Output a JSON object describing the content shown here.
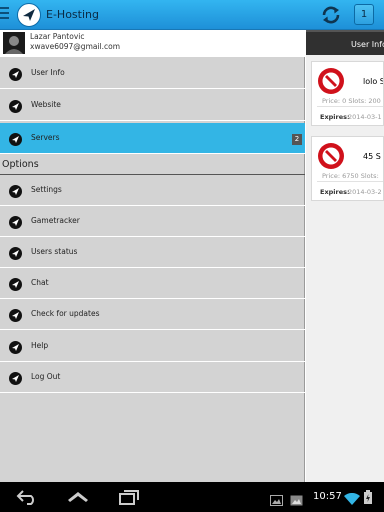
{
  "app": {
    "title": "E-Hosting"
  },
  "actionbar": {
    "badge_count": "1"
  },
  "profile": {
    "name": "Lazar Pantovic",
    "email": "xwave6097@gmail.com"
  },
  "menu": {
    "main": [
      {
        "label": "User Info"
      },
      {
        "label": "Website"
      },
      {
        "label": "Servers",
        "count": "2"
      }
    ],
    "options_header": "Options",
    "options": [
      {
        "label": "Settings"
      },
      {
        "label": "Gametracker"
      },
      {
        "label": "Users status"
      },
      {
        "label": "Chat"
      },
      {
        "label": "Check for updates"
      },
      {
        "label": "Help"
      },
      {
        "label": "Log Out"
      }
    ]
  },
  "panel": {
    "header": "User Info",
    "cards": [
      {
        "title": "lolo S",
        "price": "Price: 0 Slots: 200",
        "expires_label": "Expires:",
        "expires": "2014-03-1"
      },
      {
        "title": "45 S",
        "price": "Price: 6750 Slots:",
        "expires_label": "Expires:",
        "expires": "2014-03-2"
      }
    ]
  },
  "status": {
    "time": "10:57"
  },
  "colors": {
    "accent": "#33b5e5",
    "actionbar": "#1e90d8",
    "drawer": "#d3d3d3",
    "stop_red": "#d0111b"
  }
}
